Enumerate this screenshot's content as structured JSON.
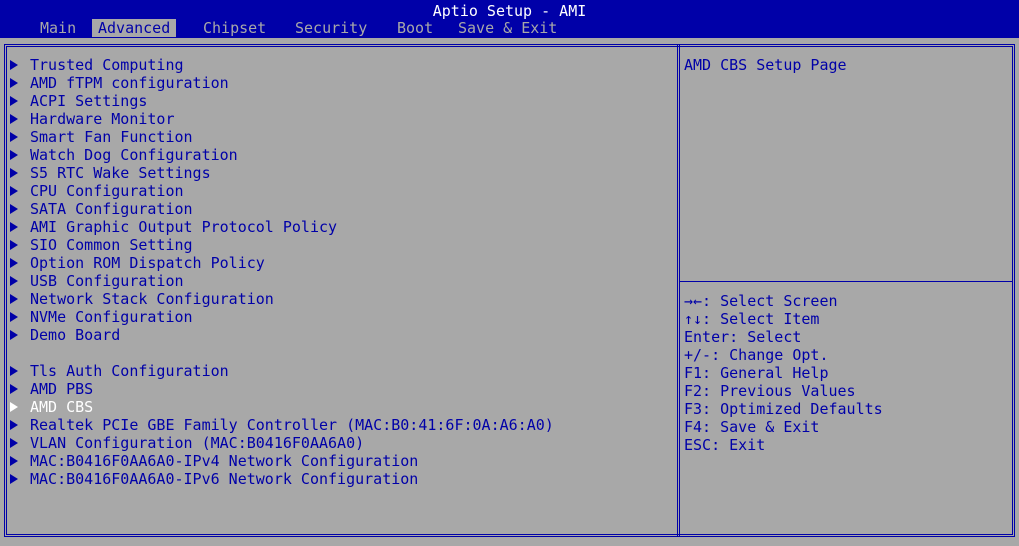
{
  "window": {
    "title": "Aptio Setup - AMI"
  },
  "tabs": [
    {
      "label": "Main"
    },
    {
      "label": "Advanced"
    },
    {
      "label": "Chipset"
    },
    {
      "label": "Security"
    },
    {
      "label": "Boot"
    },
    {
      "label": "Save & Exit"
    }
  ],
  "menu": [
    {
      "label": "Trusted Computing"
    },
    {
      "label": "AMD fTPM configuration"
    },
    {
      "label": "ACPI Settings"
    },
    {
      "label": "Hardware Monitor"
    },
    {
      "label": "Smart Fan Function"
    },
    {
      "label": "Watch Dog Configuration"
    },
    {
      "label": "S5 RTC Wake Settings"
    },
    {
      "label": "CPU Configuration"
    },
    {
      "label": "SATA Configuration"
    },
    {
      "label": "AMI Graphic Output Protocol Policy"
    },
    {
      "label": "SIO Common Setting"
    },
    {
      "label": "Option ROM Dispatch Policy"
    },
    {
      "label": "USB Configuration"
    },
    {
      "label": "Network Stack Configuration"
    },
    {
      "label": "NVMe Configuration"
    },
    {
      "label": "Demo Board"
    },
    {
      "label": "Tls Auth Configuration"
    },
    {
      "label": "AMD PBS"
    },
    {
      "label": "AMD CBS"
    },
    {
      "label": "Realtek PCIe GBE Family Controller (MAC:B0:41:6F:0A:A6:A0)"
    },
    {
      "label": "VLAN Configuration (MAC:B0416F0AA6A0)"
    },
    {
      "label": "MAC:B0416F0AA6A0-IPv4 Network Configuration"
    },
    {
      "label": "MAC:B0416F0AA6A0-IPv6 Network Configuration"
    }
  ],
  "help_text": "AMD CBS Setup Page",
  "key_help": [
    {
      "text": "→←: Select Screen"
    },
    {
      "text": "↑↓: Select Item"
    },
    {
      "text": "Enter: Select"
    },
    {
      "text": "+/-: Change Opt."
    },
    {
      "text": "F1: General Help"
    },
    {
      "text": "F2: Previous Values"
    },
    {
      "text": "F3: Optimized Defaults"
    },
    {
      "text": "F4: Save & Exit"
    },
    {
      "text": "ESC: Exit"
    }
  ],
  "colors": {
    "background": "#a8a8a8",
    "accent": "#0000a8",
    "highlight_text": "#ffffff"
  }
}
